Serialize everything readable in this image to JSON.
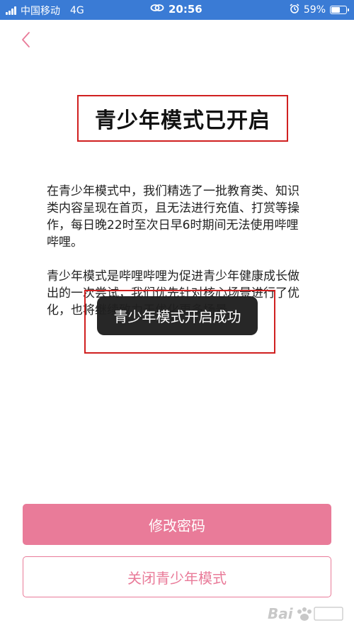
{
  "status_bar": {
    "carrier": "中国移动",
    "network": "4G",
    "time": "20:56",
    "battery_percent": "59%",
    "battery_level": 0.59,
    "icons": [
      "signal-icon",
      "link-icon",
      "alarm-icon",
      "battery-icon"
    ]
  },
  "nav": {
    "back_icon": "chevron-left-icon"
  },
  "page": {
    "title": "青少年模式已开启",
    "paragraph_1": "在青少年模式中，我们精选了一批教育类、知识类内容呈现在首页，且无法进行充值、打赏等操作，每日晚22时至次日早6时期间无法使用哔哩哔哩。",
    "paragraph_2": "青少年模式是哔哩哔哩为促进青少年健康成长做出的一次尝试，我们优先针对核心场景进行了优化，也将继续致力于优化更多场景。"
  },
  "toast": {
    "message": "青少年模式开启成功"
  },
  "actions": {
    "change_password": "修改密码",
    "close_mode": "关闭青少年模式"
  },
  "colors": {
    "status_bar": "#3a7bd5",
    "accent": "#e97b99",
    "annotation": "#d02020",
    "toast_bg": "#1f1f1f"
  }
}
